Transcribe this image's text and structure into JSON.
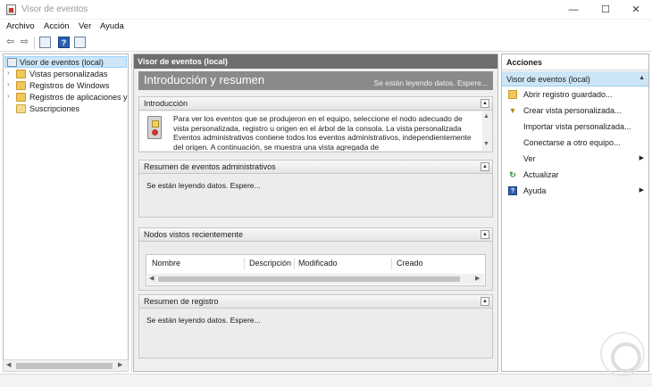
{
  "window": {
    "title": "Visor de eventos",
    "minimize": "—",
    "maximize": "☐",
    "close": "✕"
  },
  "menu": {
    "items": [
      "Archivo",
      "Acción",
      "Ver",
      "Ayuda"
    ]
  },
  "toolbar": {
    "back": "⇦",
    "forward": "⇨",
    "help": "?"
  },
  "tree": {
    "root": "Visor de eventos (local)",
    "items": [
      {
        "label": "Vistas personalizadas",
        "icon": "folder-icon"
      },
      {
        "label": "Registros de Windows",
        "icon": "folder-icon"
      },
      {
        "label": "Registros de aplicaciones y s",
        "icon": "folder-icon"
      },
      {
        "label": "Suscripciones",
        "icon": "subscriptions-icon"
      }
    ],
    "expander": "›"
  },
  "center": {
    "header": "Visor de eventos (local)",
    "banner_title": "Introducción y resumen",
    "banner_status": "Se están leyendo datos. Espere...",
    "sections": {
      "intro": {
        "title": "Introducción",
        "text": "Para ver los eventos que se produjeron en el equipo, seleccione el nodo adecuado de vista personalizada, registro u origen en el árbol de la consola. La vista personalizada Eventos administrativos contiene todos los eventos administrativos, independientemente del origen. A continuación, se muestra una vista agregada de"
      },
      "admin_summary": {
        "title": "Resumen de eventos administrativos",
        "text": "Se están leyendo datos. Espere..."
      },
      "recent_nodes": {
        "title": "Nodos vistos recientemente",
        "columns": [
          "Nombre",
          "Descripción",
          "Modificado",
          "Creado"
        ]
      },
      "log_summary": {
        "title": "Resumen de registro",
        "text": "Se están leyendo datos. Espere..."
      }
    },
    "collapse_glyph": "▲"
  },
  "actions": {
    "header": "Acciones",
    "sub_header": "Visor de eventos (local)",
    "items": [
      {
        "label": "Abrir registro guardado...",
        "icon": "open-folder-icon"
      },
      {
        "label": "Crear vista personalizada...",
        "icon": "filter-icon"
      },
      {
        "label": "Importar vista personalizada...",
        "icon": ""
      },
      {
        "label": "Conectarse a otro equipo...",
        "icon": ""
      },
      {
        "label": "Ver",
        "icon": "",
        "submenu": true
      },
      {
        "label": "Actualizar",
        "icon": "refresh-icon"
      },
      {
        "label": "Ayuda",
        "icon": "help-icon",
        "submenu": true
      }
    ],
    "submenu_arrow": "▶",
    "collapse_arrow": "▲"
  }
}
